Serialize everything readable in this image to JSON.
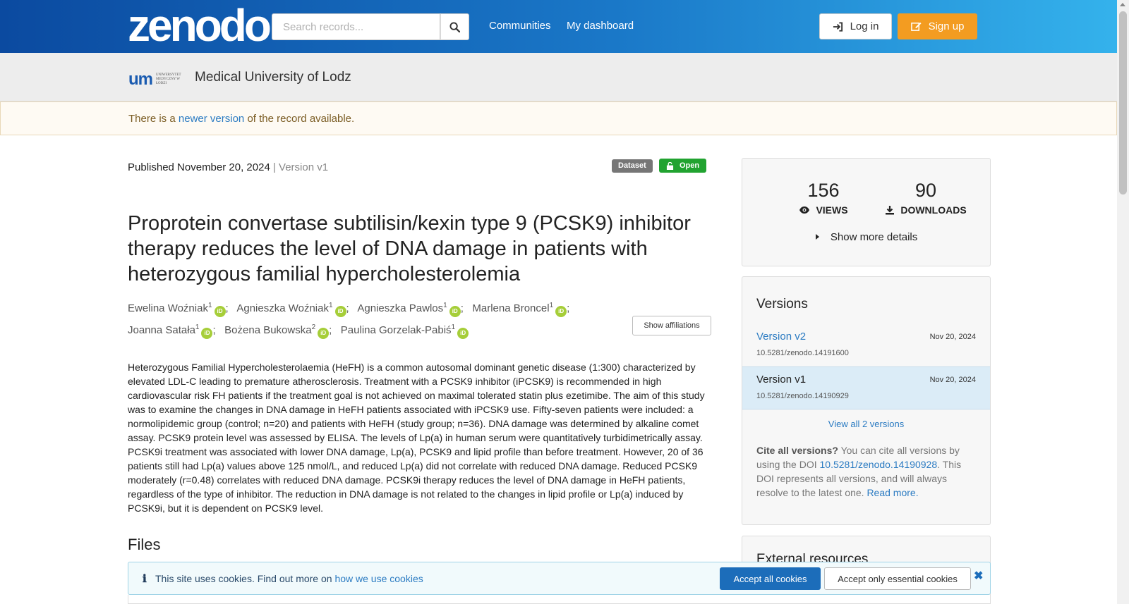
{
  "header": {
    "logo": "zenodo",
    "search_placeholder": "Search records...",
    "nav": [
      "Communities",
      "My dashboard"
    ],
    "login_label": "Log in",
    "signup_label": "Sign up"
  },
  "community": {
    "logo_mark": "um",
    "logo_text": "UNIWERSYTET MEDYCZNY W ŁODZI",
    "name": "Medical University of Lodz"
  },
  "notice": {
    "prefix": "There is a",
    "link": "newer version",
    "suffix": "of the record available."
  },
  "record": {
    "published_label": "Published November 20, 2024",
    "version_label": "| Version v1",
    "type_badge": "Dataset",
    "access_badge": "Open",
    "title": "Proprotein convertase subtilisin/kexin type 9 (PCSK9) inhibitor therapy reduces the level of DNA damage in patients with heterozygous familial hypercholesterolemia",
    "authors": [
      {
        "name": "Ewelina Woźniak",
        "aff": "1"
      },
      {
        "name": "Agnieszka Woźniak",
        "aff": "1"
      },
      {
        "name": "Agnieszka Pawlos",
        "aff": "1"
      },
      {
        "name": "Marlena Broncel",
        "aff": "1"
      },
      {
        "name": "Joanna Satała",
        "aff": "1"
      },
      {
        "name": "Bożena Bukowska",
        "aff": "2"
      },
      {
        "name": "Paulina Gorzelak-Pabiś",
        "aff": "1"
      }
    ],
    "orcid_label": "iD",
    "show_affiliations": "Show affiliations",
    "abstract": "Heterozygous Familial Hypercholesterolaemia (HeFH) is a common autosomal dominant genetic disease (1:300) characterized by elevated LDL-C leading to premature atherosclerosis. Treatment with a PCSK9 inhibitor (iPCSK9) is recommended in high cardiovascular risk FH patients if the treatment goal is not achieved on maximal tolerated statin plus ezetimibe. The aim of this study was to examine the changes in DNA damage in HeFH patients associated with iPCSK9 use. Fifty-seven patients were included: a normolipidemic group (control; n=20) and patients with HeFH (study group; n=36). DNA damage was determined by alkaline comet assay. PCSK9 protein level was assessed by ELISA. The levels of Lp(a) in human serum were quantitatively turbidimetrically assay. PCSK9i treatment was associated with lower DNA damage, Lp(a), PCSK9 and lipid profile than before treatment. However, 20 of 36 patients still had Lp(a) values above 125 nmol/L, and reduced Lp(a) did not correlate with reduced DNA damage. Reduced PCSK9 moderately (r=0.48) correlates with reduced DNA damage. PCSK9i therapy reduces the level of DNA damage in HeFH patients, regardless of the type of inhibitor. The reduction in DNA damage is not related to the changes in lipid profile or Lp(a) induced by PCSK9i, but it is dependent on PCSK9 level.",
    "files_title": "Files"
  },
  "stats": {
    "views": "156",
    "views_label": "VIEWS",
    "downloads": "90",
    "downloads_label": "DOWNLOADS",
    "more_details": "Show more details"
  },
  "versions": {
    "title": "Versions",
    "items": [
      {
        "name": "Version v2",
        "date": "Nov 20, 2024",
        "doi": "10.5281/zenodo.14191600"
      },
      {
        "name": "Version v1",
        "date": "Nov 20, 2024",
        "doi": "10.5281/zenodo.14190929"
      }
    ],
    "view_all": "View all 2 versions",
    "cite_bold": "Cite all versions?",
    "cite_text1": "You can cite all versions by using the DOI",
    "cite_doi": "10.5281/zenodo.14190928",
    "cite_text2": ". This DOI represents all versions, and will always resolve to the latest one.",
    "read_more": "Read more."
  },
  "external": {
    "title": "External resources"
  },
  "cookies": {
    "text": "This site uses cookies. Find out more on",
    "link": "how we use cookies",
    "accept_all": "Accept all cookies",
    "accept_essential": "Accept only essential cookies"
  },
  "colors": {
    "brand_gradient_start": "#0b4aa0",
    "brand_gradient_end": "#34b2ec",
    "signup": "#f39c21",
    "open_badge": "#21a330",
    "link": "#2b7bc2",
    "orcid": "#a6ce39"
  }
}
